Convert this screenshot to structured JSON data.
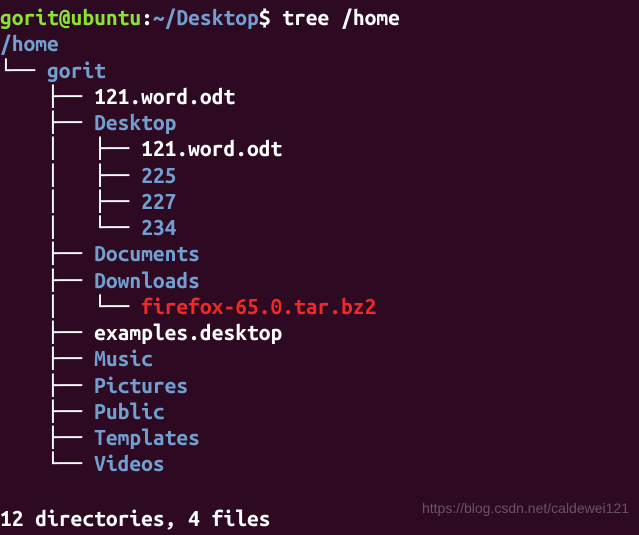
{
  "prompt": {
    "user_host": "gorit@ubuntu",
    "colon": ":",
    "path": "~/Desktop",
    "dollar": "$ ",
    "command": "tree /home"
  },
  "tree": {
    "root": "/home",
    "lines": [
      {
        "prefix": "└── ",
        "name": "gorit",
        "type": "dir"
      },
      {
        "prefix": "    ├── ",
        "name": "121.word.odt",
        "type": "file"
      },
      {
        "prefix": "    ├── ",
        "name": "Desktop",
        "type": "dir"
      },
      {
        "prefix": "    │   ├── ",
        "name": "121.word.odt",
        "type": "file"
      },
      {
        "prefix": "    │   ├── ",
        "name": "225",
        "type": "dir"
      },
      {
        "prefix": "    │   ├── ",
        "name": "227",
        "type": "dir"
      },
      {
        "prefix": "    │   └── ",
        "name": "234",
        "type": "dir"
      },
      {
        "prefix": "    ├── ",
        "name": "Documents",
        "type": "dir"
      },
      {
        "prefix": "    ├── ",
        "name": "Downloads",
        "type": "dir"
      },
      {
        "prefix": "    │   └── ",
        "name": "firefox-65.0.tar.bz2",
        "type": "archive"
      },
      {
        "prefix": "    ├── ",
        "name": "examples.desktop",
        "type": "file"
      },
      {
        "prefix": "    ├── ",
        "name": "Music",
        "type": "dir"
      },
      {
        "prefix": "    ├── ",
        "name": "Pictures",
        "type": "dir"
      },
      {
        "prefix": "    ├── ",
        "name": "Public",
        "type": "dir"
      },
      {
        "prefix": "    ├── ",
        "name": "Templates",
        "type": "dir"
      },
      {
        "prefix": "    └── ",
        "name": "Videos",
        "type": "dir"
      }
    ]
  },
  "summary": "12 directories, 4 files",
  "watermark": "https://blog.csdn.net/caldewei121"
}
